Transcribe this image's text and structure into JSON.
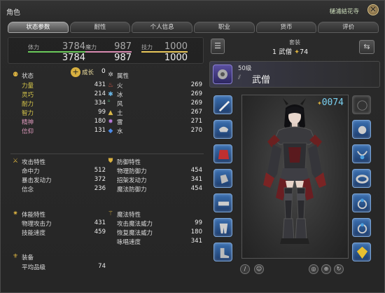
{
  "window": {
    "title": "角色",
    "owner": "樋浦結花寺",
    "close_icon": "close-icon"
  },
  "tabs": [
    {
      "label": "状态参数",
      "active": true
    },
    {
      "label": "耐性",
      "active": false
    },
    {
      "label": "个人信息",
      "active": false
    },
    {
      "label": "职业",
      "active": false
    },
    {
      "label": "货币",
      "active": false
    },
    {
      "label": "评价",
      "active": false
    }
  ],
  "vitals": [
    {
      "label": "体力",
      "current": "3784",
      "max": "3784",
      "color": "#6ac95a",
      "fraction": 1.0
    },
    {
      "label": "魔力",
      "current": "987",
      "max": "987",
      "color": "#d88ab0",
      "fraction": 1.0
    },
    {
      "label": "技力",
      "current": "1000",
      "max": "1000",
      "color": "#e7c65a",
      "fraction": 1.0
    }
  ],
  "growth": {
    "label": "成长",
    "points": "0"
  },
  "attributes": {
    "header": "状态",
    "rows": [
      {
        "label": "力量",
        "value": "431",
        "color": "#d8c84a"
      },
      {
        "label": "灵巧",
        "value": "214",
        "color": "#d8c84a"
      },
      {
        "label": "耐力",
        "value": "334",
        "color": "#d8c84a"
      },
      {
        "label": "智力",
        "value": "99",
        "color": "#d8c84a"
      },
      {
        "label": "精神",
        "value": "180",
        "color": "#d896b8"
      },
      {
        "label": "信仰",
        "value": "131",
        "color": "#d896b8"
      }
    ]
  },
  "elements": {
    "header": "属性",
    "rows": [
      {
        "label": "火",
        "value": "269",
        "icon": "fire-icon",
        "glyph": "♨",
        "color": "#e05a4a"
      },
      {
        "label": "冰",
        "value": "269",
        "icon": "ice-icon",
        "glyph": "✱",
        "color": "#6ab8e8"
      },
      {
        "label": "风",
        "value": "269",
        "icon": "wind-icon",
        "glyph": "ꩰ",
        "color": "#5ac88a"
      },
      {
        "label": "土",
        "value": "267",
        "icon": "earth-icon",
        "glyph": "▲",
        "color": "#d8b84a"
      },
      {
        "label": "雷",
        "value": "271",
        "icon": "lightning-icon",
        "glyph": "✸",
        "color": "#b87ad8"
      },
      {
        "label": "水",
        "value": "270",
        "icon": "water-icon",
        "glyph": "◆",
        "color": "#4a8ae8"
      }
    ]
  },
  "offense": {
    "header": "攻击特性",
    "rows": [
      {
        "label": "命中力",
        "value": "512"
      },
      {
        "label": "暴击发动力",
        "value": "372"
      },
      {
        "label": "信念",
        "value": "236"
      }
    ]
  },
  "defense": {
    "header": "防御特性",
    "rows": [
      {
        "label": "物理防御力",
        "value": "454"
      },
      {
        "label": "招架发动力",
        "value": "341"
      },
      {
        "label": "魔法防御力",
        "value": "454"
      }
    ]
  },
  "physical": {
    "header": "体能特性",
    "rows": [
      {
        "label": "物理攻击力",
        "value": "431"
      },
      {
        "label": "技能速度",
        "value": "459"
      }
    ]
  },
  "magic": {
    "header": "魔法特性",
    "rows": [
      {
        "label": "攻击魔法威力",
        "value": "99"
      },
      {
        "label": "恢复魔法威力",
        "value": "180"
      },
      {
        "label": "咏唱速度",
        "value": "341"
      }
    ]
  },
  "gear": {
    "header": "装备",
    "rows": [
      {
        "label": "平均品级",
        "value": "74"
      }
    ]
  },
  "gearset": {
    "label": "套装",
    "number": "1",
    "job": "武僧",
    "item_level": "74"
  },
  "job": {
    "level": "50级",
    "name": "武僧"
  },
  "portrait": {
    "item_level": "0074"
  },
  "left_slots": [
    "weapon-slot",
    "head-slot",
    "body-slot",
    "hands-slot",
    "waist-slot",
    "legs-slot",
    "feet-slot"
  ],
  "right_slots": [
    "offhand-slot-empty",
    "ears-slot",
    "neck-slot",
    "wrists-slot",
    "ring-slot",
    "ring-slot-2",
    "soul-crystal-slot"
  ]
}
